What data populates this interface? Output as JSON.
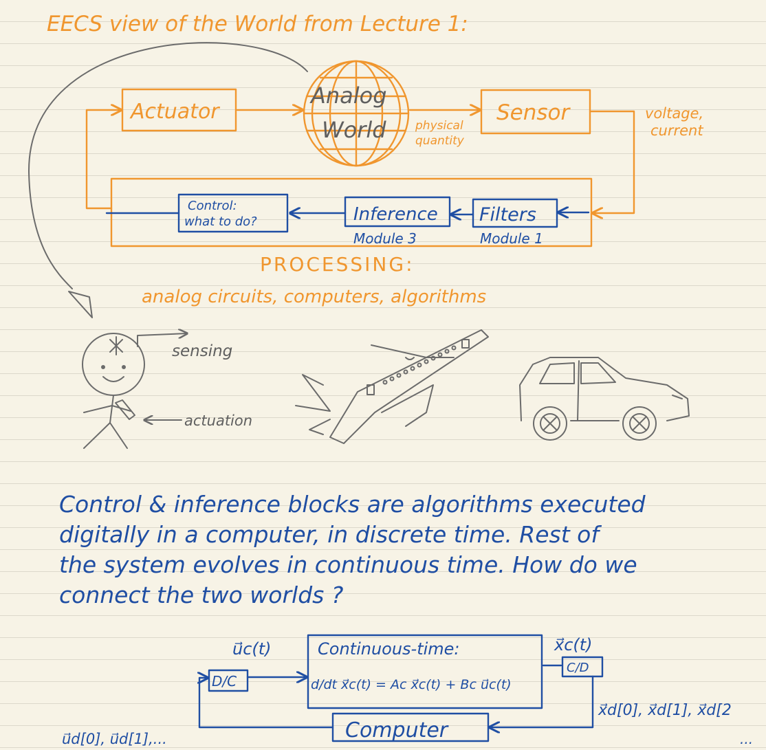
{
  "title": "EECS view of the World from Lecture 1:",
  "loop": {
    "actuator": "Actuator",
    "world_line1": "Analog",
    "world_line2": "World",
    "physical_line1": "physical",
    "physical_line2": "quantity",
    "sensor": "Sensor",
    "voltage_line1": "voltage,",
    "voltage_line2": "current",
    "control_line1": "Control:",
    "control_line2": "what to do?",
    "inference": "Inference",
    "inference_module": "Module 3",
    "filters": "Filters",
    "filters_module": "Module 1",
    "processing": "PROCESSING:",
    "processing_sub": "analog circuits, computers, algorithms"
  },
  "examples": {
    "sensing": "sensing",
    "actuation": "actuation"
  },
  "paragraph": [
    "Control & inference blocks are algorithms executed",
    "digitally in a computer, in discrete time. Rest of",
    "the system evolves in continuous time. How do we",
    "connect the two worlds ?"
  ],
  "bottom": {
    "uc_label": "u⃗c(t)",
    "dc": "D/C",
    "ct_title": "Continuous-time:",
    "ct_eq": "d/dt x⃗c(t) = Ac x⃗c(t) + Bc u⃗c(t)",
    "xc_label": "x⃗c(t)",
    "cd": "C/D",
    "xd_seq": "x⃗d[0], x⃗d[1], x⃗d[2",
    "ellipsis": "...",
    "computer": "Computer",
    "ud_seq": "u⃗d[0], u⃗d[1],..."
  },
  "colors": {
    "orange": "#f0962e",
    "blue": "#1f4ea3",
    "gray": "#6b6b6b",
    "paper": "#f7f3e6"
  }
}
